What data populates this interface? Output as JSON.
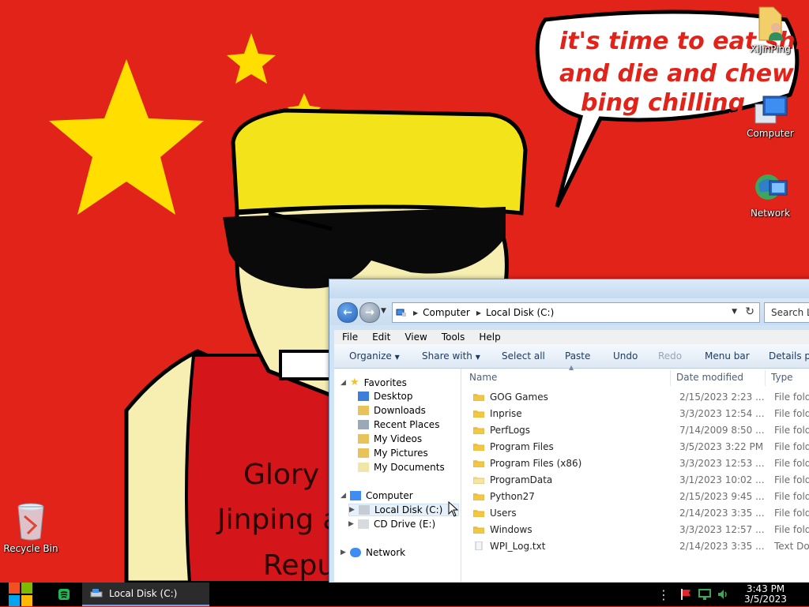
{
  "desktop": {
    "speech_bubble": [
      "it's time to eat shi",
      "and die and chew",
      "bing chilling"
    ],
    "poster_text": [
      "Glory t",
      "Jinping a",
      "Repu"
    ],
    "icons": [
      {
        "label": "XiJinPing",
        "icon": "user-folder-icon"
      },
      {
        "label": "Computer",
        "icon": "computer-icon"
      },
      {
        "label": "Network",
        "icon": "network-icon"
      },
      {
        "label": "Recycle Bin",
        "icon": "recycle-bin-icon"
      }
    ]
  },
  "explorer": {
    "address": {
      "crumbs": [
        "Computer",
        "Local Disk (C:)"
      ]
    },
    "search_placeholder": "Search L",
    "menu": [
      "File",
      "Edit",
      "View",
      "Tools",
      "Help"
    ],
    "commands": [
      {
        "label": "Organize",
        "enabled": true
      },
      {
        "label": "Share with",
        "enabled": true
      },
      {
        "label": "Select all",
        "enabled": true
      },
      {
        "label": "Paste",
        "enabled": true
      },
      {
        "label": "Undo",
        "enabled": true
      },
      {
        "label": "Redo",
        "enabled": false
      },
      {
        "label": "Menu bar",
        "enabled": true
      },
      {
        "label": "Details pa",
        "enabled": true
      }
    ],
    "nav": {
      "favorites": "Favorites",
      "favorite_items": [
        "Desktop",
        "Downloads",
        "Recent Places",
        "My Videos",
        "My Pictures",
        "My Documents"
      ],
      "computer": "Computer",
      "computer_items": [
        "Local Disk (C:)",
        "CD Drive (E:)"
      ],
      "network": "Network"
    },
    "columns": {
      "name": "Name",
      "date": "Date modified",
      "type": "Type"
    },
    "files": [
      {
        "name": "GOG Games",
        "date": "2/15/2023 2:23 ...",
        "type": "File fold",
        "kind": "folder"
      },
      {
        "name": "Inprise",
        "date": "3/3/2023 12:54 ...",
        "type": "File fold",
        "kind": "folder"
      },
      {
        "name": "PerfLogs",
        "date": "7/14/2009 8:50 ...",
        "type": "File fold",
        "kind": "folder"
      },
      {
        "name": "Program Files",
        "date": "3/5/2023 3:22 PM",
        "type": "File fold",
        "kind": "folder"
      },
      {
        "name": "Program Files (x86)",
        "date": "3/3/2023 12:53 ...",
        "type": "File fold",
        "kind": "folder"
      },
      {
        "name": "ProgramData",
        "date": "3/1/2023 10:02 ...",
        "type": "File fold",
        "kind": "folder-hidden"
      },
      {
        "name": "Python27",
        "date": "2/15/2023 9:45 ...",
        "type": "File fold",
        "kind": "folder"
      },
      {
        "name": "Users",
        "date": "2/14/2023 3:35 ...",
        "type": "File fold",
        "kind": "folder"
      },
      {
        "name": "Windows",
        "date": "3/3/2023 12:57 ...",
        "type": "File fold",
        "kind": "folder"
      },
      {
        "name": "WPI_Log.txt",
        "date": "2/14/2023 3:35 ...",
        "type": "Text Do",
        "kind": "text-file"
      }
    ]
  },
  "taskbar": {
    "active_window": "Local Disk (C:)",
    "clock_time": "3:43 PM",
    "clock_date": "3/5/2023"
  }
}
